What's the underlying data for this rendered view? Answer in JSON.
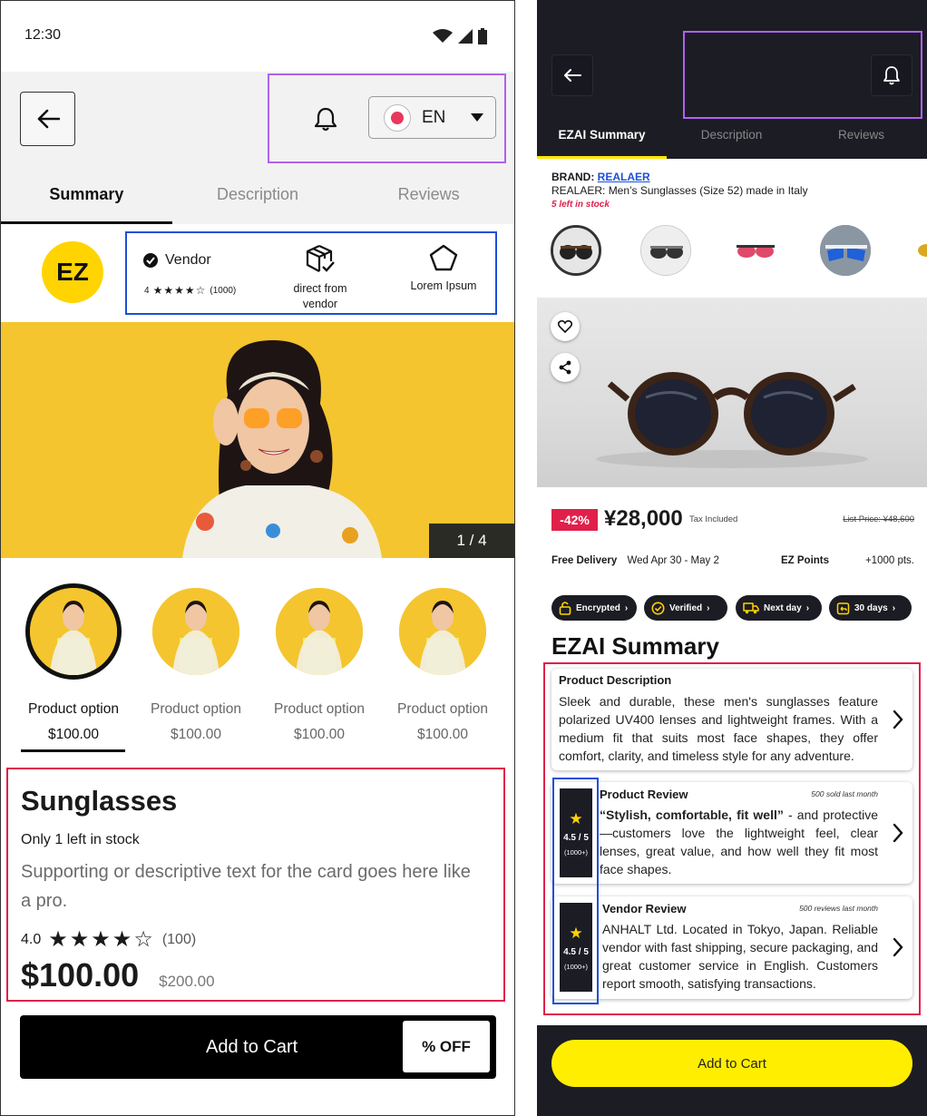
{
  "left": {
    "status": {
      "time": "12:30"
    },
    "header": {
      "language": "EN"
    },
    "tabs": [
      "Summary",
      "Description",
      "Reviews"
    ],
    "vendor": {
      "logo": "EZ",
      "label": "Vendor",
      "rating_value": "4",
      "rating_stars": 4,
      "rating_count": "(1000)",
      "feature_1": "direct from\nvendor",
      "feature_2": "Lorem Ipsum"
    },
    "hero": {
      "page_indicator": "1 / 4"
    },
    "options": [
      {
        "label": "Product option",
        "price": "$100.00"
      },
      {
        "label": "Product option",
        "price": "$100.00"
      },
      {
        "label": "Product option",
        "price": "$100.00"
      },
      {
        "label": "Product option",
        "price": "$100.00"
      }
    ],
    "product": {
      "title": "Sunglasses",
      "stock": "Only 1 left in stock",
      "description": "Supporting or descriptive text for the card goes here like a pro.",
      "rating_value": "4.0",
      "rating_stars": 4,
      "rating_count": "(100)",
      "price": "$100.00",
      "old_price": "$200.00"
    },
    "cta": {
      "add_to_cart": "Add to Cart",
      "discount": "% OFF"
    }
  },
  "right": {
    "tabs": [
      "EZAI Summary",
      "Description",
      "Reviews"
    ],
    "brand": {
      "label": "BRAND:",
      "name": "REALAER",
      "subtitle": "REALAER:  Men’s Sunglasses (Size 52)  made in Italy",
      "stock": "5 left in stock"
    },
    "price": {
      "discount": "-42%",
      "amount": "¥28,000",
      "tax": "Tax Included",
      "list_price": "List Price: ¥48,600"
    },
    "delivery": {
      "label": "Free Delivery",
      "dates": "Wed Apr 30 - May 2",
      "points_label": "EZ Points",
      "points_value": "+1000 pts."
    },
    "badges": [
      "Encrypted",
      "Verified",
      "Next day",
      "30 days"
    ],
    "summary_title": "EZAI Summary",
    "cards": {
      "description": {
        "title": "Product Description",
        "body": "Sleek and durable, these men's sunglasses feature polarized UV400 lenses and lightweight frames. With a medium fit that suits most face shapes, they offer comfort, clarity, and timeless style for any adventure."
      },
      "product_review": {
        "title": "Product Review",
        "meta": "500 sold last month",
        "quote": "“Stylish, comfortable, fit well”",
        "body": " - and protective—customers love the lightweight feel, clear lenses, great value, and how well they fit most face shapes.",
        "rating": "4.5 / 5",
        "count": "(1000+)"
      },
      "vendor_review": {
        "title": "Vendor Review",
        "meta": "500 reviews last month",
        "body": "ANHALT Ltd. Located in Tokyo, Japan. Reliable vendor with fast shipping, secure packaging, and great customer service in English. Customers report smooth, satisfying transactions.",
        "rating": "4.5 / 5",
        "count": "(1000+)"
      }
    },
    "cta": {
      "add_to_cart": "Add to Cart"
    }
  },
  "colors": {
    "accent_yellow": "#ffd400",
    "cta_yellow": "#ffee00",
    "dark_bg": "#1c1c24",
    "discount_red": "#e0204a",
    "highlight_purple": "#b061f0",
    "highlight_blue": "#1d4fd8",
    "highlight_red": "#e0204a"
  },
  "icons": [
    "back-arrow-icon",
    "bell-icon",
    "chevron-down-icon",
    "check-circle-icon",
    "package-check-icon",
    "pentagon-icon",
    "star-icon",
    "heart-icon",
    "share-icon",
    "chevron-right-icon",
    "lock-icon",
    "verified-badge-icon",
    "truck-icon",
    "return-icon"
  ]
}
